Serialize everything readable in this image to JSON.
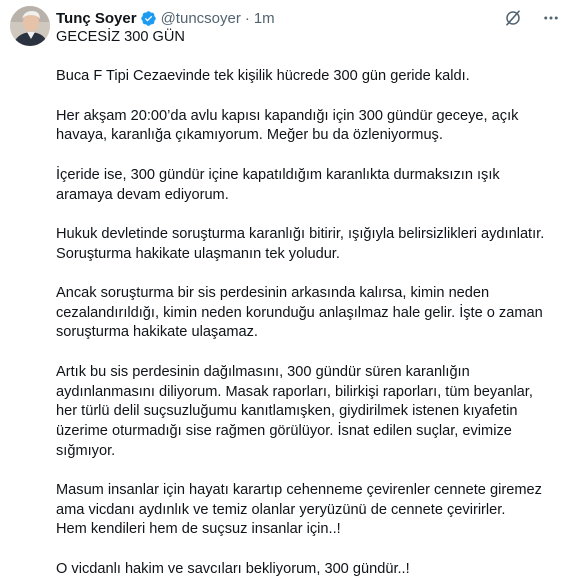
{
  "author": {
    "name": "Tunç Soyer",
    "handle": "@tuncsoyer",
    "separator": "·",
    "time": "1m",
    "verified": true
  },
  "icons": {
    "verified": "verified-badge-icon",
    "grok": "grok-icon",
    "more": "more-options-icon"
  },
  "colors": {
    "text": "#0f1419",
    "muted": "#536471",
    "verified": "#1d9bf0"
  },
  "tweet": {
    "title": "GECESİZ 300 GÜN",
    "paragraphs": [
      [
        "Buca F Tipi Cezaevinde tek kişilik hücrede 300 gün geride kaldı."
      ],
      [
        "Her akşam 20:00’da avlu kapısı kapandığı için 300 gündür geceye, açık",
        "havaya, karanlığa çıkamıyorum. Meğer bu da özleniyormuş."
      ],
      [
        "İçeride ise, 300 gündür içine kapatıldığım karanlıkta durmaksızın ışık",
        "aramaya devam ediyorum."
      ],
      [
        "Hukuk devletinde soruşturma karanlığı bitirir, ışığıyla belirsizlikleri aydınlatır.",
        "Soruşturma hakikate ulaşmanın tek yoludur."
      ],
      [
        "Ancak soruşturma bir sis perdesinin arkasında kalırsa, kimin neden",
        "cezalandırıldığı, kimin neden korunduğu anlaşılmaz hale gelir. İşte o zaman",
        "soruşturma hakikate ulaşamaz."
      ],
      [
        "Artık bu sis perdesinin dağılmasını, 300 gündür süren karanlığın",
        "aydınlanmasını diliyorum. Masak raporları, bilirkişi raporları, tüm beyanlar,",
        "her türlü delil suçsuzluğumu kanıtlamışken, giydirilmek istenen kıyafetin",
        "üzerime oturmadığı sise rağmen görülüyor. İsnat edilen suçlar, evimize",
        "sığmıyor."
      ],
      [
        "Masum insanlar için hayatı karartıp cehenneme çevirenler cennete giremez",
        "ama vicdanı aydınlık ve temiz olanlar yeryüzünü de cennete çevirirler.",
        "Hem kendileri hem de suçsuz insanlar için..!"
      ],
      [
        "O vicdanlı hakim ve savcıları bekliyorum, 300 gündür..!"
      ]
    ]
  }
}
